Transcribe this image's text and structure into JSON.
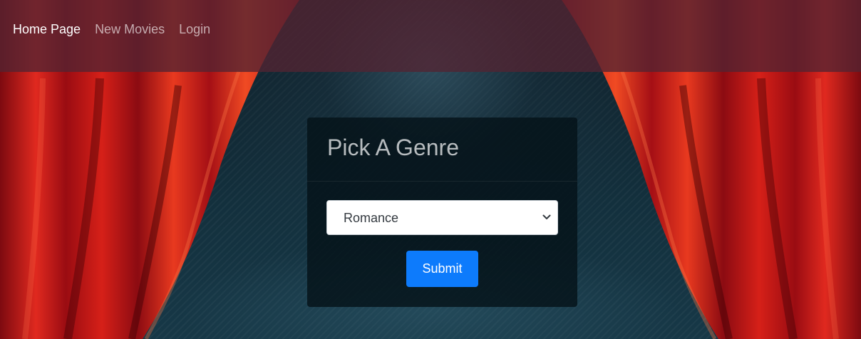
{
  "nav": {
    "items": [
      {
        "label": "Home Page",
        "active": true
      },
      {
        "label": "New Movies",
        "active": false
      },
      {
        "label": "Login",
        "active": false
      }
    ]
  },
  "genre_form": {
    "title": "Pick A Genre",
    "selected_genre": "Romance",
    "submit_label": "Submit"
  },
  "colors": {
    "curtain_red": "#b5121b",
    "navbar_bg": "#522432",
    "submit_bg": "#0d7bfc",
    "card_bg": "#051218"
  },
  "icons": {
    "select_arrow": "chevron-down-icon"
  }
}
